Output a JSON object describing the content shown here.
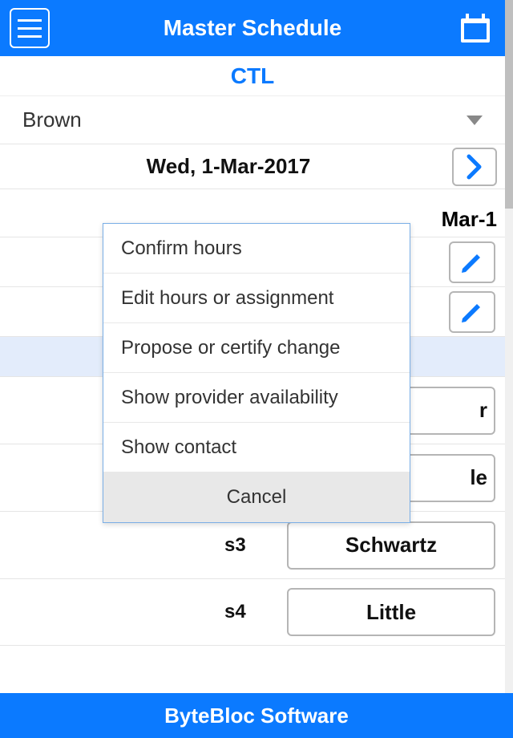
{
  "header": {
    "title": "Master Schedule"
  },
  "subheader": {
    "label": "CTL"
  },
  "provider": {
    "selected": "Brown"
  },
  "date": {
    "label": "Wed, 1-Mar-2017"
  },
  "columns": {
    "date_short": "Mar-1"
  },
  "rows": [
    {
      "shift": "",
      "assignee": "",
      "has_edit": true
    },
    {
      "shift": "",
      "assignee": "",
      "has_edit": true
    },
    {
      "shift": "",
      "assignee": "",
      "band": true
    },
    {
      "shift": "",
      "assignee_suffix": "r"
    },
    {
      "shift": "",
      "assignee_suffix": "le"
    },
    {
      "shift": "s3",
      "assignee": "Schwartz"
    },
    {
      "shift": "s4",
      "assignee": "Little"
    }
  ],
  "modal": {
    "items": [
      "Confirm hours",
      "Edit hours or assignment",
      "Propose or certify change",
      "Show provider availability",
      "Show contact"
    ],
    "cancel": "Cancel"
  },
  "footer": {
    "label": "ByteBloc Software"
  }
}
